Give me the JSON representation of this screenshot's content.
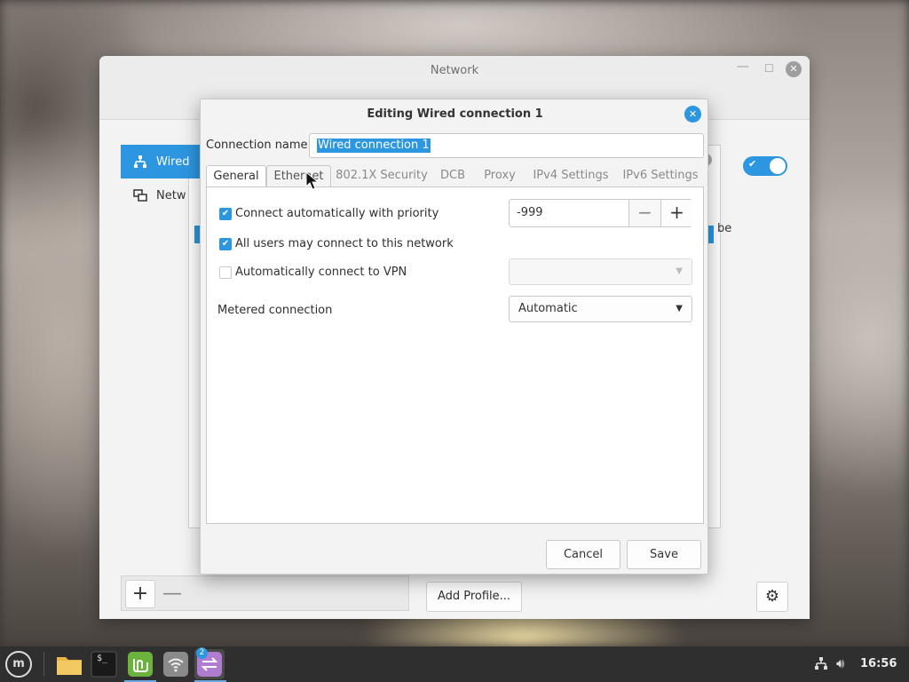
{
  "network_window": {
    "title": "Network",
    "sidebar": {
      "items": [
        {
          "label": "Wired",
          "icon": "wired-network-icon"
        },
        {
          "label": "Netw",
          "icon": "network-proxy-icon"
        }
      ]
    },
    "partial_text": "be",
    "add_profile_label": "Add Profile...",
    "add_symbol": "+",
    "remove_symbol": "—"
  },
  "dialog": {
    "title": "Editing Wired connection 1",
    "connection_name_label": "Connection name",
    "connection_name_value": "Wired connection 1",
    "tabs": [
      {
        "label": "General",
        "active": true
      },
      {
        "label": "Ethernet",
        "active": false
      },
      {
        "label": "802.1X Security",
        "active": false
      },
      {
        "label": "DCB",
        "active": false
      },
      {
        "label": "Proxy",
        "active": false
      },
      {
        "label": "IPv4 Settings",
        "active": false
      },
      {
        "label": "IPv6 Settings",
        "active": false
      }
    ],
    "general": {
      "auto_connect_label": "Connect automatically with priority",
      "auto_connect_checked": true,
      "priority_value": "-999",
      "all_users_label": "All users may connect to this network",
      "all_users_checked": true,
      "vpn_label": "Automatically connect to VPN",
      "vpn_checked": false,
      "vpn_selected": "",
      "metered_label": "Metered connection",
      "metered_selected": "Automatic"
    },
    "cancel_label": "Cancel",
    "save_label": "Save"
  },
  "taskbar": {
    "apps": [
      {
        "name": "Files",
        "icon": "folder-icon"
      },
      {
        "name": "Terminal",
        "icon": "terminal-icon"
      },
      {
        "name": "Mint",
        "icon": "mint-icon"
      },
      {
        "name": "Wi-Fi",
        "icon": "wifi-icon"
      },
      {
        "name": "Network",
        "icon": "network-app-icon"
      }
    ],
    "badge_count": "2",
    "terminal_prompt": "$_",
    "menu_glyph": "m",
    "clock": "16:56"
  },
  "colors": {
    "accent": "#2d96e0",
    "folder": "#e8b64a",
    "terminal": "#1a1a1a",
    "mint": "#6cb33e",
    "wifi": "#8a8a8a",
    "network_app": "#b07cd0"
  }
}
